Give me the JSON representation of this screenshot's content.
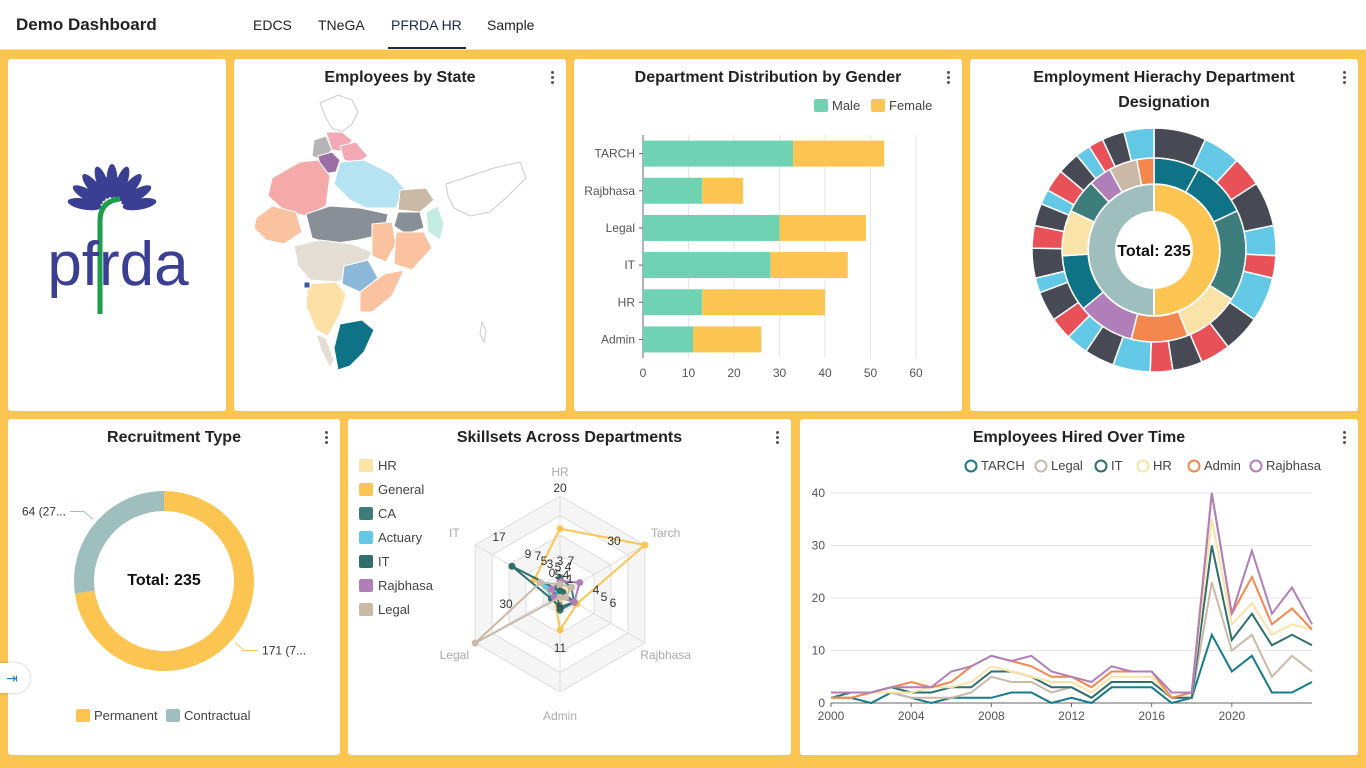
{
  "app": {
    "title": "Demo Dashboard"
  },
  "tabs": [
    {
      "label": "EDCS",
      "active": false
    },
    {
      "label": "TNeGA",
      "active": false
    },
    {
      "label": "PFRDA HR",
      "active": true
    },
    {
      "label": "Sample",
      "active": false
    }
  ],
  "logo": {
    "text": "pfrda",
    "brand_color": "#3a3f94",
    "stem_color": "#1d9e4a"
  },
  "cards": {
    "state": {
      "title": "Employees by State"
    },
    "gender": {
      "title": "Department Distribution by Gender"
    },
    "hierarchy": {
      "title_line1": "Employment Hierachy Department",
      "title_line2": "Designation",
      "center_label": "Total: 235"
    },
    "recruitment": {
      "title": "Recruitment Type",
      "center_label": "Total: 235"
    },
    "skills": {
      "title": "Skillsets Across Departments"
    },
    "hired": {
      "title": "Employees Hired Over Time"
    }
  },
  "chart_data": [
    {
      "id": "gender",
      "type": "bar",
      "orientation": "horizontal",
      "stacked": true,
      "categories": [
        "Admin",
        "HR",
        "IT",
        "Legal",
        "Rajbhasa",
        "TARCH"
      ],
      "series": [
        {
          "name": "Male",
          "color": "#6fd3b3",
          "values": [
            11,
            13,
            28,
            30,
            13,
            33
          ]
        },
        {
          "name": "Female",
          "color": "#fcc552",
          "values": [
            15,
            27,
            17,
            19,
            9,
            20
          ]
        }
      ],
      "xlim": [
        0,
        60
      ],
      "xticks": [
        "0",
        "10",
        "20",
        "30",
        "40",
        "50",
        "60"
      ],
      "legend": "top-right",
      "grid": true
    },
    {
      "id": "recruitment",
      "type": "pie",
      "donut": true,
      "slices": [
        {
          "name": "Permanent",
          "value": 171,
          "label": "171 (7...",
          "color": "#fcc552"
        },
        {
          "name": "Contractual",
          "value": 64,
          "label": "64 (27...",
          "color": "#9fbfbf"
        }
      ],
      "total": 235,
      "legend": "bottom"
    },
    {
      "id": "skills",
      "type": "radar",
      "axes": [
        "HR",
        "Tarch",
        "Rajbhasa",
        "Admin",
        "Legal",
        "IT"
      ],
      "max": 20,
      "series": [
        {
          "name": "HR",
          "color": "#fae3a8",
          "values": [
            3,
            2,
            2,
            2,
            2,
            2
          ]
        },
        {
          "name": "General",
          "color": "#fcc552",
          "values": [
            20,
            30,
            6,
            11,
            2,
            9
          ]
        },
        {
          "name": "CA",
          "color": "#3d7e7c",
          "values": [
            5,
            4,
            5,
            5,
            1,
            2
          ]
        },
        {
          "name": "Actuary",
          "color": "#62c8e6",
          "values": [
            0,
            1,
            1,
            1,
            3,
            5
          ]
        },
        {
          "name": "IT",
          "color": "#2f6f6c",
          "values": [
            1,
            1,
            5,
            4,
            3,
            17
          ]
        },
        {
          "name": "Rajbhasa",
          "color": "#b07fb9",
          "values": [
            4,
            7,
            5,
            1,
            2,
            3
          ]
        },
        {
          "name": "Legal",
          "color": "#c9b9a6",
          "values": [
            3,
            4,
            2,
            1,
            30,
            7
          ]
        }
      ],
      "value_labels": [
        "20",
        "30",
        "6",
        "11",
        "30",
        "17",
        "9",
        "7",
        "5",
        "3",
        "5",
        "3",
        "4",
        "7",
        "4",
        "5",
        "5",
        "5",
        "4",
        "0",
        "1"
      ],
      "legend": "left"
    },
    {
      "id": "hired",
      "type": "line",
      "x": [
        2000,
        2001,
        2002,
        2003,
        2004,
        2005,
        2006,
        2007,
        2008,
        2009,
        2010,
        2011,
        2012,
        2013,
        2014,
        2015,
        2016,
        2017,
        2018,
        2019,
        2020,
        2021,
        2022,
        2023,
        2024
      ],
      "xticks": [
        "2000",
        "2004",
        "2008",
        "2012",
        "2016",
        "2020"
      ],
      "ylim": [
        0,
        40
      ],
      "yticks": [
        "0",
        "10",
        "20",
        "30",
        "40"
      ],
      "legend": "top-right",
      "grid": true,
      "series": [
        {
          "name": "TARCH",
          "color": "#177b8b",
          "values": [
            1,
            1,
            0,
            2,
            1,
            0,
            1,
            1,
            1,
            2,
            2,
            0,
            1,
            0,
            3,
            3,
            3,
            0,
            1,
            13,
            6,
            9,
            2,
            2,
            4
          ]
        },
        {
          "name": "Legal",
          "color": "#c9b9a6",
          "values": [
            1,
            1,
            2,
            2,
            1,
            1,
            1,
            2,
            5,
            4,
            4,
            2,
            3,
            1,
            4,
            4,
            4,
            1,
            1,
            23,
            10,
            13,
            5,
            9,
            6
          ]
        },
        {
          "name": "IT",
          "color": "#2f6f6c",
          "values": [
            1,
            2,
            2,
            3,
            2,
            2,
            3,
            3,
            6,
            6,
            5,
            3,
            3,
            1,
            4,
            4,
            4,
            1,
            1,
            30,
            12,
            17,
            11,
            13,
            11
          ]
        },
        {
          "name": "HR",
          "color": "#fae3a8",
          "values": [
            1,
            1,
            2,
            2,
            2,
            3,
            3,
            4,
            7,
            6,
            5,
            4,
            4,
            2,
            5,
            5,
            5,
            1,
            2,
            35,
            15,
            19,
            13,
            15,
            14
          ]
        },
        {
          "name": "Admin",
          "color": "#f4874e",
          "values": [
            1,
            1,
            2,
            3,
            4,
            3,
            4,
            7,
            9,
            8,
            7,
            5,
            5,
            3,
            6,
            6,
            6,
            1,
            2,
            40,
            17,
            24,
            15,
            18,
            14
          ]
        },
        {
          "name": "Rajbhasa",
          "color": "#b07fb9",
          "values": [
            2,
            2,
            2,
            3,
            3,
            3,
            6,
            7,
            9,
            8,
            9,
            6,
            5,
            4,
            7,
            6,
            6,
            2,
            2,
            40,
            17,
            29,
            17,
            22,
            15
          ]
        }
      ]
    }
  ]
}
